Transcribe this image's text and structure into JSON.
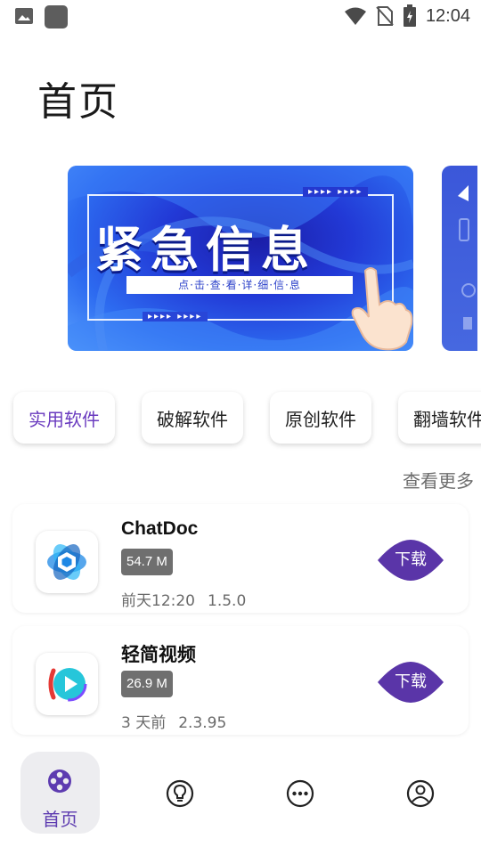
{
  "status_bar": {
    "time": "12:04",
    "icons": [
      "image-icon",
      "app-icon",
      "wifi-icon",
      "no-sim-icon",
      "battery-charging-icon"
    ]
  },
  "page": {
    "title": "首页"
  },
  "banner": {
    "headline": "紧急信息",
    "subline": "点·击·查·看·详·细·信·息",
    "arrows": "▸▸▸▸ ▸▸▸▸",
    "colors": {
      "primary": "#2239d6",
      "light": "#5aa3ff"
    }
  },
  "categories": {
    "items": [
      {
        "label": "实用软件",
        "active": true
      },
      {
        "label": "破解软件",
        "active": false
      },
      {
        "label": "原创软件",
        "active": false
      },
      {
        "label": "翻墙软件",
        "active": false
      }
    ]
  },
  "section": {
    "see_more": "查看更多"
  },
  "apps": [
    {
      "name": "ChatDoc",
      "size": "54.7 M",
      "date": "前天12:20",
      "version": "1.5.0",
      "button": "下载",
      "icon": "chatdoc-logo-icon"
    },
    {
      "name": "轻简视频",
      "size": "26.9 M",
      "date": "3 天前",
      "version": "2.3.95",
      "button": "下载",
      "icon": "video-play-logo-icon"
    }
  ],
  "bottom_nav": {
    "items": [
      {
        "label": "首页",
        "icon": "film-reel-icon",
        "active": true
      },
      {
        "label": "",
        "icon": "lightbulb-icon",
        "active": false
      },
      {
        "label": "",
        "icon": "more-dots-icon",
        "active": false
      },
      {
        "label": "",
        "icon": "account-icon",
        "active": false
      }
    ]
  },
  "colors": {
    "accent": "#6a3bbf",
    "download_button": "#5a35a8"
  }
}
